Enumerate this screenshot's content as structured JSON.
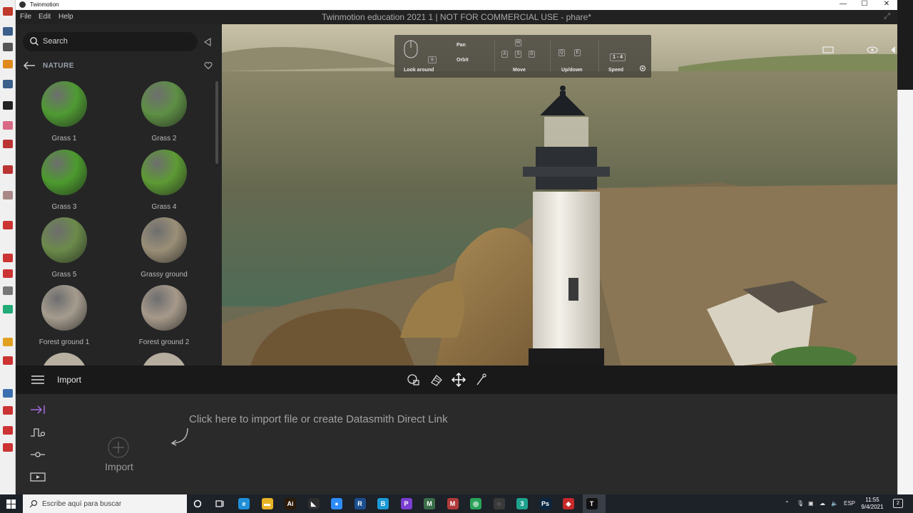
{
  "os_titlebar": {
    "app_name": "Twinmotion",
    "minimize": "—",
    "maximize": "☐",
    "close": "✕"
  },
  "menubar": {
    "items": [
      "File",
      "Edit",
      "Help"
    ],
    "window_title": "Twinmotion education 2021 1 | NOT FOR COMMERCIAL USE - phare*"
  },
  "library": {
    "search_placeholder": "Search",
    "category": "NATURE",
    "materials": [
      {
        "label": "Grass 1",
        "color": "#4f9a33"
      },
      {
        "label": "Grass 2",
        "color": "#5e8f45"
      },
      {
        "label": "Grass 3",
        "color": "#4c9a2e"
      },
      {
        "label": "Grass 4",
        "color": "#5d9a34"
      },
      {
        "label": "Grass 5",
        "color": "#6b8a4a"
      },
      {
        "label": "Grassy ground",
        "color": "#9a8f77"
      },
      {
        "label": "Forest ground 1",
        "color": "#a59c8e"
      },
      {
        "label": "Forest ground 2",
        "color": "#a6998a"
      }
    ]
  },
  "nav_hud": {
    "look_around": "Look around",
    "pan": "Pan",
    "orbit": "Orbit",
    "move": "Move",
    "up_down": "Up/down",
    "speed": "Speed",
    "speed_values": "1 - 4",
    "keys": {
      "w": "W",
      "a": "A",
      "s": "S",
      "d": "D",
      "q": "Q",
      "e": "E"
    }
  },
  "bottom_bar": {
    "title": "Import"
  },
  "import_panel": {
    "hint": "Click here to import file or create Datasmith Direct Link",
    "import_label": "Import"
  },
  "taskbar": {
    "search_placeholder": "Escribe aquí para buscar",
    "lang": "ESP",
    "time": "11:55",
    "date": "9/4/2021",
    "notifications": "2",
    "apps": [
      {
        "name": "edge",
        "color": "#1f8fd8",
        "glyph": "e"
      },
      {
        "name": "explorer",
        "color": "#e8b427",
        "glyph": "▬"
      },
      {
        "name": "illustrator",
        "color": "#2b1a09",
        "glyph": "Ai"
      },
      {
        "name": "nvidia",
        "color": "#2e2e2e",
        "glyph": "◣"
      },
      {
        "name": "zoom",
        "color": "#2d8cff",
        "glyph": "●"
      },
      {
        "name": "revit",
        "color": "#1c4f8f",
        "glyph": "R"
      },
      {
        "name": "b-app",
        "color": "#1b9ad6",
        "glyph": "B"
      },
      {
        "name": "podcast",
        "color": "#7a3fd1",
        "glyph": "P"
      },
      {
        "name": "map-app",
        "color": "#3a6e4a",
        "glyph": "M"
      },
      {
        "name": "m-app",
        "color": "#b03a3a",
        "glyph": "M"
      },
      {
        "name": "green-app",
        "color": "#2aa35a",
        "glyph": "◎"
      },
      {
        "name": "circle-app",
        "color": "#3a3a3a",
        "glyph": "◌"
      },
      {
        "name": "three-app",
        "color": "#1fa38f",
        "glyph": "3"
      },
      {
        "name": "photoshop",
        "color": "#0a2540",
        "glyph": "Ps"
      },
      {
        "name": "sketchup",
        "color": "#c62a2a",
        "glyph": "◆"
      },
      {
        "name": "twinmotion",
        "color": "#111111",
        "glyph": "T"
      }
    ]
  }
}
